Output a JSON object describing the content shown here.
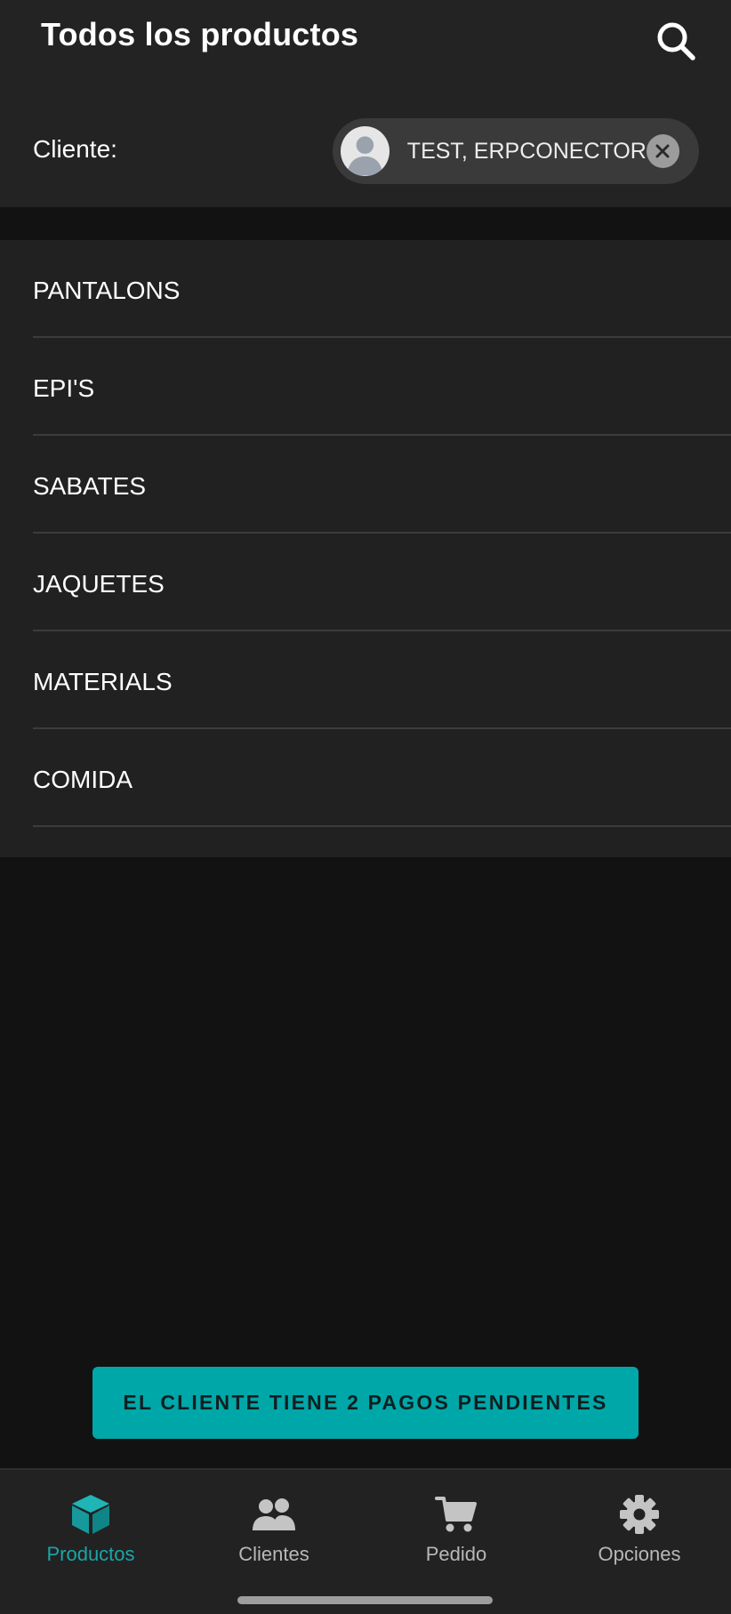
{
  "header": {
    "title": "Todos los productos",
    "search_icon": "search-icon"
  },
  "client": {
    "label": "Cliente:",
    "name": "TEST, ERPCONECTOR",
    "avatar_icon": "person-avatar-icon",
    "clear_icon": "close-icon"
  },
  "categories": [
    {
      "label": "PANTALONS"
    },
    {
      "label": "EPI'S"
    },
    {
      "label": "SABATES"
    },
    {
      "label": "JAQUETES"
    },
    {
      "label": "MATERIALS"
    },
    {
      "label": "COMIDA"
    }
  ],
  "pending_button": {
    "label": "EL CLIENTE TIENE 2 PAGOS PENDIENTES"
  },
  "bottom_nav": {
    "items": [
      {
        "label": "Productos",
        "icon": "box-icon",
        "active": true
      },
      {
        "label": "Clientes",
        "icon": "users-icon",
        "active": false
      },
      {
        "label": "Pedido",
        "icon": "cart-icon",
        "active": false
      },
      {
        "label": "Opciones",
        "icon": "gear-icon",
        "active": false
      }
    ]
  },
  "colors": {
    "accent": "#00a7a9",
    "background": "#121212",
    "surface": "#232323",
    "chip": "#3a3a3a"
  }
}
